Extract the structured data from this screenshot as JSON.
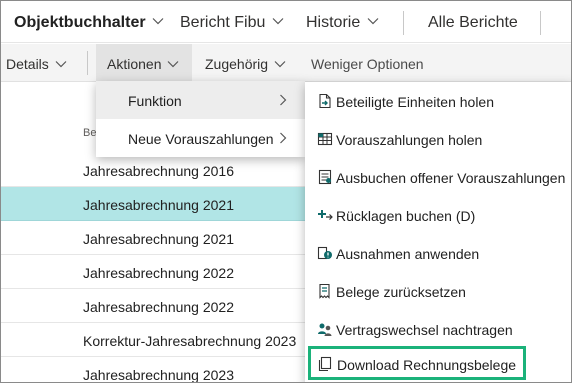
{
  "topnav": {
    "items": [
      {
        "label": "Objektbuchhalter",
        "has_dropdown": true
      },
      {
        "label": "Bericht Fibu",
        "has_dropdown": true
      },
      {
        "label": "Historie",
        "has_dropdown": true
      },
      {
        "label": "Alle Berichte",
        "has_dropdown": false
      }
    ]
  },
  "actionbar": {
    "items": [
      {
        "label": "Details",
        "has_dropdown": true
      },
      {
        "label": "Aktionen",
        "has_dropdown": true,
        "active": true
      },
      {
        "label": "Zugehörig",
        "has_dropdown": true
      },
      {
        "label": "Weniger Optionen",
        "has_dropdown": false
      }
    ]
  },
  "list": {
    "column_header": "Be",
    "rows": [
      {
        "label": "Jahresabrechnung 2016",
        "selected": false
      },
      {
        "label": "Jahresabrechnung 2021",
        "selected": true
      },
      {
        "label": "Jahresabrechnung 2021",
        "selected": false
      },
      {
        "label": "Jahresabrechnung 2022",
        "selected": false
      },
      {
        "label": "Jahresabrechnung 2022",
        "selected": false
      },
      {
        "label": "Korrektur-Jahresabrechnung 2023",
        "selected": false
      },
      {
        "label": "Jahresabrechnung 2023",
        "selected": false
      }
    ]
  },
  "menu_level1": {
    "items": [
      {
        "label": "Funktion",
        "hover": true
      },
      {
        "label": "Neue Vorauszahlungen",
        "hover": false
      }
    ]
  },
  "menu_level2": {
    "items": [
      {
        "label": "Beteiligte Einheiten holen",
        "icon": "document-arrow-icon"
      },
      {
        "label": "Vorauszahlungen holen",
        "icon": "grid-icon"
      },
      {
        "label": "Ausbuchen offener Vorauszahlungen",
        "icon": "ledger-icon"
      },
      {
        "label": "Rücklagen buchen (D)",
        "icon": "plus-arrow-icon"
      },
      {
        "label": "Ausnahmen anwenden",
        "icon": "exception-icon"
      },
      {
        "label": "Belege zurücksetzen",
        "icon": "receipt-reset-icon"
      },
      {
        "label": "Vertragswechsel nachtragen",
        "icon": "people-swap-icon"
      },
      {
        "label": "Download Rechnungsbelege",
        "icon": "copy-document-icon",
        "focused": true
      }
    ]
  },
  "colors": {
    "selected_row": "#b1e5e6",
    "focus_border": "#1bb27a",
    "icon_accent": "#0f6b6b"
  }
}
